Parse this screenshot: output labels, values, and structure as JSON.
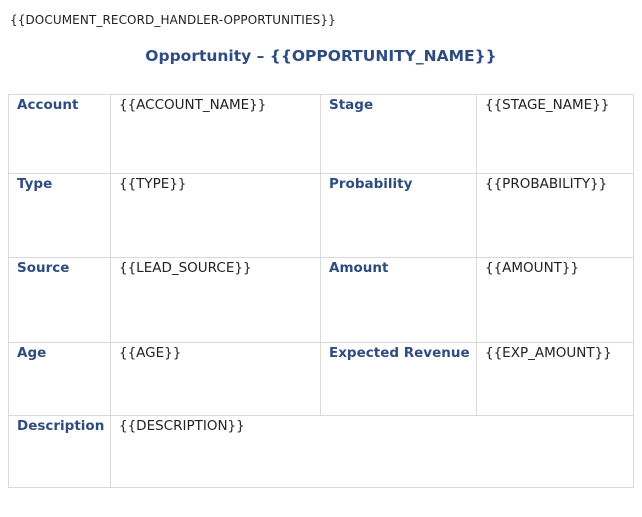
{
  "handler_tag": "{{DOCUMENT_RECORD_HANDLER-OPPORTUNITIES}}",
  "title": "Opportunity – {{OPPORTUNITY_NAME}}",
  "rows": [
    {
      "label1": "Account",
      "value1": "{{ACCOUNT_NAME}}",
      "label2": "Stage",
      "value2": "{{STAGE_NAME}}"
    },
    {
      "label1": "Type",
      "value1": "{{TYPE}}",
      "label2": "Probability",
      "value2": "{{PROBABILITY}}"
    },
    {
      "label1": "Source",
      "value1": "{{LEAD_SOURCE}}",
      "label2": "Amount",
      "value2": "{{AMOUNT}}"
    },
    {
      "label1": "Age",
      "value1": "{{AGE}}",
      "label2": "Expected Revenue",
      "value2": "{{EXP_AMOUNT}}"
    }
  ],
  "description": {
    "label": "Description",
    "value": "{{DESCRIPTION}}"
  },
  "colors": {
    "label": "#2E4C80",
    "border": "#d9d9d9",
    "text": "#222222"
  }
}
